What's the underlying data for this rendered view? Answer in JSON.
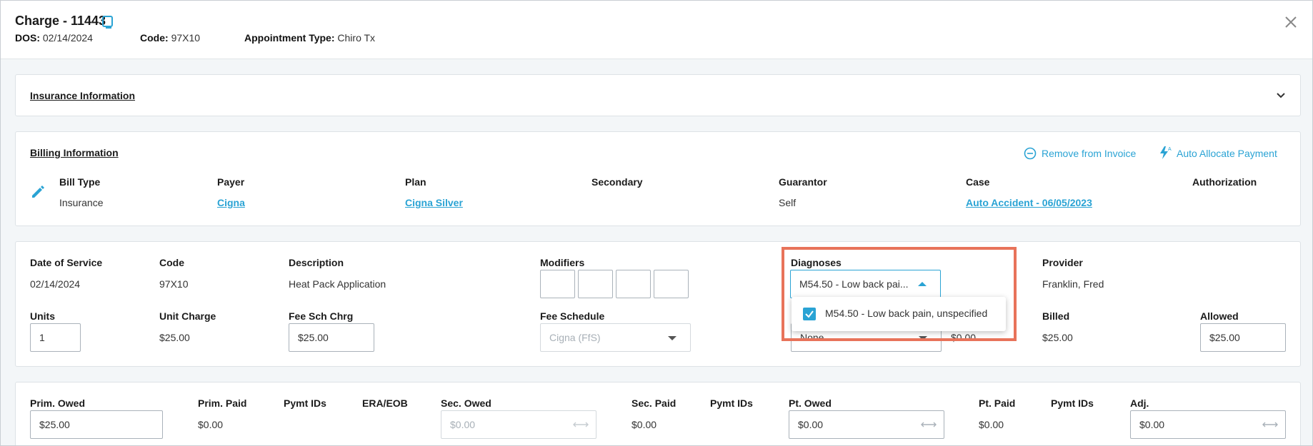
{
  "header": {
    "title": "Charge - 11443",
    "dos_label": "DOS:",
    "dos_value": "02/14/2024",
    "code_label": "Code:",
    "code_value": "97X10",
    "appt_label": "Appointment Type:",
    "appt_value": "Chiro Tx"
  },
  "insurance": {
    "title": "Insurance Information"
  },
  "billing": {
    "title": "Billing Information",
    "remove_label": "Remove from Invoice",
    "auto_allocate_label": "Auto Allocate Payment",
    "bill_type_label": "Bill Type",
    "bill_type_value": "Insurance",
    "payer_label": "Payer",
    "payer_value": "Cigna",
    "plan_label": "Plan",
    "plan_value": "Cigna Silver",
    "secondary_label": "Secondary",
    "guarantor_label": "Guarantor",
    "guarantor_value": "Self",
    "case_label": "Case",
    "case_value": "Auto Accident - 06/05/2023",
    "authorization_label": "Authorization"
  },
  "charge": {
    "dos_label": "Date of Service",
    "dos_value": "02/14/2024",
    "code_label": "Code",
    "code_value": "97X10",
    "desc_label": "Description",
    "desc_value": "Heat Pack Application",
    "modifiers_label": "Modifiers",
    "diagnoses_label": "Diagnoses",
    "diagnoses_selected": "M54.50 - Low back pai...",
    "diagnoses_option": "M54.50 - Low back pain, unspecified",
    "provider_label": "Provider",
    "provider_value": "Franklin, Fred",
    "units_label": "Units",
    "units_value": "1",
    "unit_charge_label": "Unit Charge",
    "unit_charge_value": "$25.00",
    "fee_sch_chrg_label": "Fee Sch Chrg",
    "fee_sch_chrg_value": "$25.00",
    "fee_schedule_label": "Fee Schedule",
    "fee_schedule_value": "Cigna (FfS)",
    "hidden_select_value": "None",
    "hidden_amount_value": "$0.00",
    "billed_label": "Billed",
    "billed_value": "$25.00",
    "allowed_label": "Allowed",
    "allowed_value": "$25.00"
  },
  "payments": {
    "prim_owed_label": "Prim. Owed",
    "prim_owed_value": "$25.00",
    "prim_paid_label": "Prim. Paid",
    "prim_paid_value": "$0.00",
    "pymt_ids_label": "Pymt IDs",
    "era_eob_label": "ERA/EOB",
    "sec_owed_label": "Sec. Owed",
    "sec_owed_value": "$0.00",
    "sec_paid_label": "Sec. Paid",
    "sec_paid_value": "$0.00",
    "pt_owed_label": "Pt. Owed",
    "pt_owed_value": "$0.00",
    "pt_paid_label": "Pt. Paid",
    "pt_paid_value": "$0.00",
    "adj_label": "Adj.",
    "adj_value": "$0.00"
  },
  "colors": {
    "accent": "#2aa3d4",
    "highlight": "#e8735a"
  },
  "icons": {
    "copy": "copy-icon",
    "close": "close-icon",
    "chevron": "chevron-down-icon",
    "remove": "minus-circle-icon",
    "auto": "lightning-icon",
    "edit": "pencil-icon"
  }
}
